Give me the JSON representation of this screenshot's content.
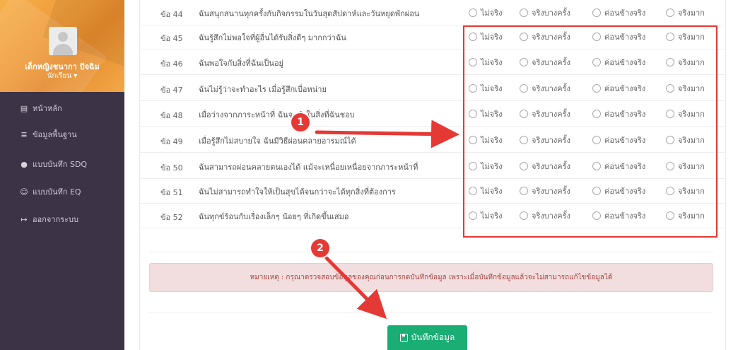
{
  "sidebar": {
    "user_name": "เด็กหญิงชนากา ปัจฉิม",
    "user_role": "นักเรียน ▾",
    "items": [
      {
        "label": "หน้าหลัก",
        "icon": "dashboard-icon",
        "glyph": "▤"
      },
      {
        "label": "ข้อมูลพื้นฐาน",
        "icon": "database-icon",
        "glyph": "≣"
      },
      {
        "label": "แบบบันทึก SDQ",
        "icon": "check-circle-icon",
        "glyph": "●"
      },
      {
        "label": "แบบบันทึก EQ",
        "icon": "smile-icon",
        "glyph": "☺"
      },
      {
        "label": "ออกจากระบบ",
        "icon": "sign-out-icon",
        "glyph": "↦"
      }
    ]
  },
  "options": [
    "ไม่จริง",
    "จริงบางครั้ง",
    "ค่อนข้างจริง",
    "จริงมาก"
  ],
  "questions": [
    {
      "num": "ข้อ 44",
      "text": "ฉันสนุกสนานทุกครั้งกับกิจกรรมในวันสุดสัปดาห์และวันหยุดพักผ่อน"
    },
    {
      "num": "ข้อ 45",
      "text": "ฉันรู้สึกไม่พอใจที่ผู้อื่นได้รับสิ่งดีๆ มากกว่าฉัน"
    },
    {
      "num": "ข้อ 46",
      "text": "ฉันพอใจกับสิ่งที่ฉันเป็นอยู่"
    },
    {
      "num": "ข้อ 47",
      "text": "ฉันไม่รู้ว่าจะทำอะไร เมื่อรู้สึกเบื่อหน่าย"
    },
    {
      "num": "ข้อ 48",
      "text": "เมื่อว่างจากภาระหน้าที่ ฉันจะทำในสิ่งที่ฉันชอบ"
    },
    {
      "num": "ข้อ 49",
      "text": "เมื่อรู้สึกไม่สบายใจ ฉันมีวิธีผ่อนคลายอารมณ์ได้"
    },
    {
      "num": "ข้อ 50",
      "text": "ฉันสามารถผ่อนคลายตนเองได้ แม้จะเหนื่อยเหนื่อยจากภาระหน้าที่"
    },
    {
      "num": "ข้อ 51",
      "text": "ฉันไม่สามารถทำใจให้เป็นสุขได้จนกว่าจะได้ทุกสิ่งที่ต้องการ"
    },
    {
      "num": "ข้อ 52",
      "text": "ฉันทุกข์ร้อนกับเรื่องเล็กๆ น้อยๆ ที่เกิดขึ้นเสมอ"
    }
  ],
  "note": "หมายเหตุ : กรุณาตรวจสอบข้อมูลของคุณก่อนการกดบันทึกข้อมูล เพราะเมื่อบันทึกข้อมูลแล้วจะไม่สามารถแก้ไขข้อมูลได้",
  "save_label": "บันทึกข้อมูล",
  "annotations": {
    "badge1": "1",
    "badge2": "2",
    "color": "#e53935"
  },
  "colors": {
    "sidebar": "#3d3346",
    "profile": "#f3a03e",
    "save": "#1aad74",
    "note_bg": "#f2dede",
    "note_text": "#a94442"
  }
}
